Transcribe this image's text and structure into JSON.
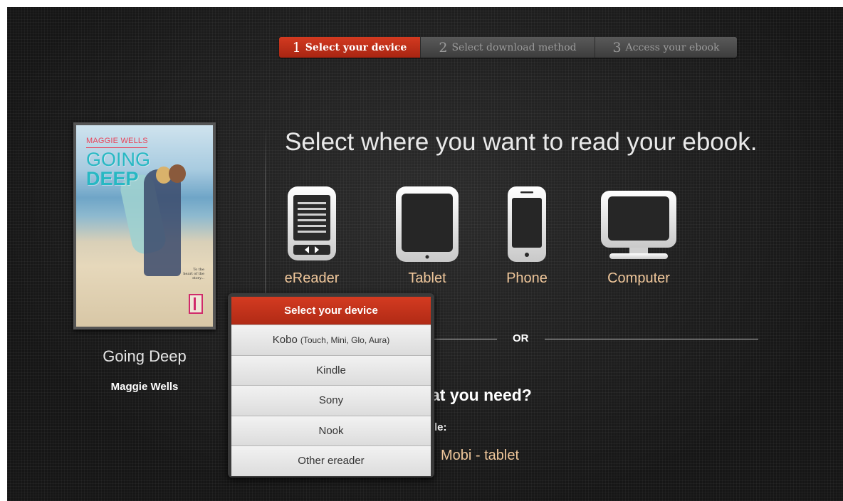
{
  "steps": [
    {
      "num": "1",
      "label": "Select your device",
      "active": true
    },
    {
      "num": "2",
      "label": "Select download method",
      "active": false
    },
    {
      "num": "3",
      "label": "Access your ebook",
      "active": false
    }
  ],
  "book": {
    "cover_author": "MAGGIE WELLS",
    "cover_title_line1": "GOING",
    "cover_title_line2": "DEEP",
    "cover_tagline": "To the heart of the story...",
    "title": "Going Deep",
    "author": "Maggie Wells"
  },
  "headline": "Select where you want to read your ebook.",
  "devices": [
    {
      "label": "eReader",
      "icon": "ereader-icon"
    },
    {
      "label": "Tablet",
      "icon": "tablet-icon"
    },
    {
      "label": "Phone",
      "icon": "phone-icon"
    },
    {
      "label": "Computer",
      "icon": "computer-icon"
    }
  ],
  "or_text": "OR",
  "need_text": "at you need?",
  "title_label": "tle:",
  "format_link": "Mobi - tablet",
  "dropdown": {
    "header": "Select your device",
    "items": [
      {
        "label": "Kobo",
        "sub": "(Touch, Mini, Glo, Aura)"
      },
      {
        "label": "Kindle",
        "sub": ""
      },
      {
        "label": "Sony",
        "sub": ""
      },
      {
        "label": "Nook",
        "sub": ""
      },
      {
        "label": "Other ereader",
        "sub": ""
      }
    ]
  },
  "colors": {
    "accent_red": "#c5311a",
    "link_orange": "#f0c79b",
    "background": "#1d1d1d"
  }
}
